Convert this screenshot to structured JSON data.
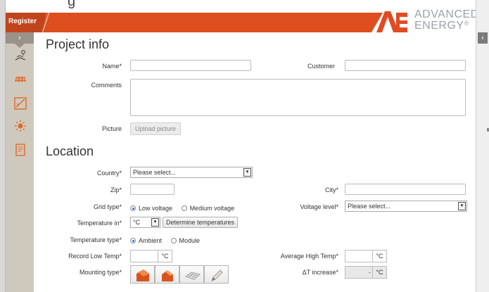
{
  "top_strip": {
    "clipped_text": "g"
  },
  "header": {
    "active_tab": "Register"
  },
  "logo": {
    "line1": "ADVANCED",
    "line2": "ENERGY",
    "trademark": "®"
  },
  "sidebar": {
    "toggle_glyph": "›",
    "items": [
      {
        "icon": "site-map-icon"
      },
      {
        "icon": "solar-panel-icon"
      },
      {
        "icon": "chart-icon"
      },
      {
        "icon": "sun-icon"
      },
      {
        "icon": "report-icon"
      }
    ]
  },
  "right_edge": {
    "collapse_glyph": "‹"
  },
  "project_info": {
    "title": "Project info",
    "name_label": "Name*",
    "name_value": "",
    "customer_label": "Customer",
    "customer_value": "",
    "comments_label": "Comments",
    "picture_label": "Picture",
    "upload_button": "Upload picture"
  },
  "location": {
    "title": "Location",
    "country_label": "Country*",
    "country_value": "Please select...",
    "zip_label": "Zip*",
    "city_label": "City*",
    "grid_type_label": "Grid type*",
    "grid_options": [
      "Low voltage",
      "Medium voltage"
    ],
    "grid_selected": "Low voltage",
    "voltage_level_label": "Voltage level*",
    "voltage_level_value": "Please select...",
    "temperature_in_label": "Temperature in*",
    "temperature_unit_value": "°C",
    "determine_button": "Determine temperatures",
    "temperature_type_label": "Temperature type*",
    "temperature_type_options": [
      "Ambient",
      "Module"
    ],
    "temperature_type_selected": "Ambient",
    "record_low_label": "Record Low Temp*",
    "record_low_unit": "°C",
    "avg_high_label": "Average High Temp*",
    "avg_high_unit": "°C",
    "mounting_type_label": "Mounting type*",
    "mounting_options": [
      "roof-pitched-icon",
      "roof-house-icon",
      "ground-array-icon",
      "pencil-icon"
    ],
    "delta_t_label": "ΔT increase*",
    "delta_t_value": "-",
    "delta_t_unit": "°C"
  },
  "colors": {
    "header_orange": "#dd4f1f",
    "sidebar_bg": "#cfc8bc",
    "icon_orange": "#e06a2c",
    "radio_selected": "#1a6fd1"
  }
}
